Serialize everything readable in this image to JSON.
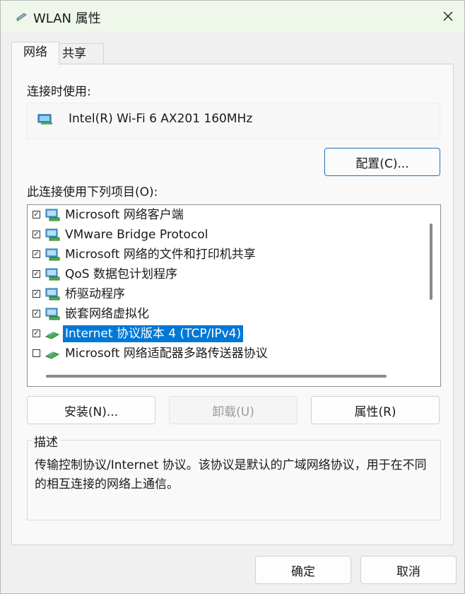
{
  "window": {
    "title": "WLAN 属性",
    "title_icon": "network-adapter-icon",
    "close_icon": "close-icon"
  },
  "tabs": [
    {
      "label": "网络",
      "active": true
    },
    {
      "label": "共享",
      "active": false
    }
  ],
  "connection": {
    "label": "连接时使用:",
    "adapter_name": "Intel(R) Wi-Fi 6 AX201 160MHz",
    "adapter_icon": "network-card-icon",
    "config_button": "配置(C)..."
  },
  "items": {
    "label": "此连接使用下列项目(O):",
    "list": [
      {
        "label": "Microsoft 网络客户端",
        "checked": true,
        "icon": "client-network-icon",
        "selected": false
      },
      {
        "label": "VMware Bridge Protocol",
        "checked": true,
        "icon": "service-network-icon",
        "selected": false
      },
      {
        "label": "Microsoft 网络的文件和打印机共享",
        "checked": true,
        "icon": "service-network-icon",
        "selected": false
      },
      {
        "label": "QoS 数据包计划程序",
        "checked": true,
        "icon": "service-network-icon",
        "selected": false
      },
      {
        "label": "桥驱动程序",
        "checked": true,
        "icon": "service-network-icon",
        "selected": false
      },
      {
        "label": "嵌套网络虚拟化",
        "checked": true,
        "icon": "service-network-icon",
        "selected": false
      },
      {
        "label": "Internet 协议版本 4 (TCP/IPv4)",
        "checked": true,
        "icon": "protocol-icon",
        "selected": true
      },
      {
        "label": "Microsoft 网络适配器多路传送器协议",
        "checked": false,
        "icon": "protocol-icon",
        "selected": false
      }
    ]
  },
  "buttons": {
    "install": "安装(N)...",
    "uninstall": "卸载(U)",
    "properties": "属性(R)",
    "ok": "确定",
    "cancel": "取消"
  },
  "description": {
    "title": "描述",
    "text": "传输控制协议/Internet 协议。该协议是默认的广域网络协议，用于在不同的相互连接的网络上通信。"
  }
}
